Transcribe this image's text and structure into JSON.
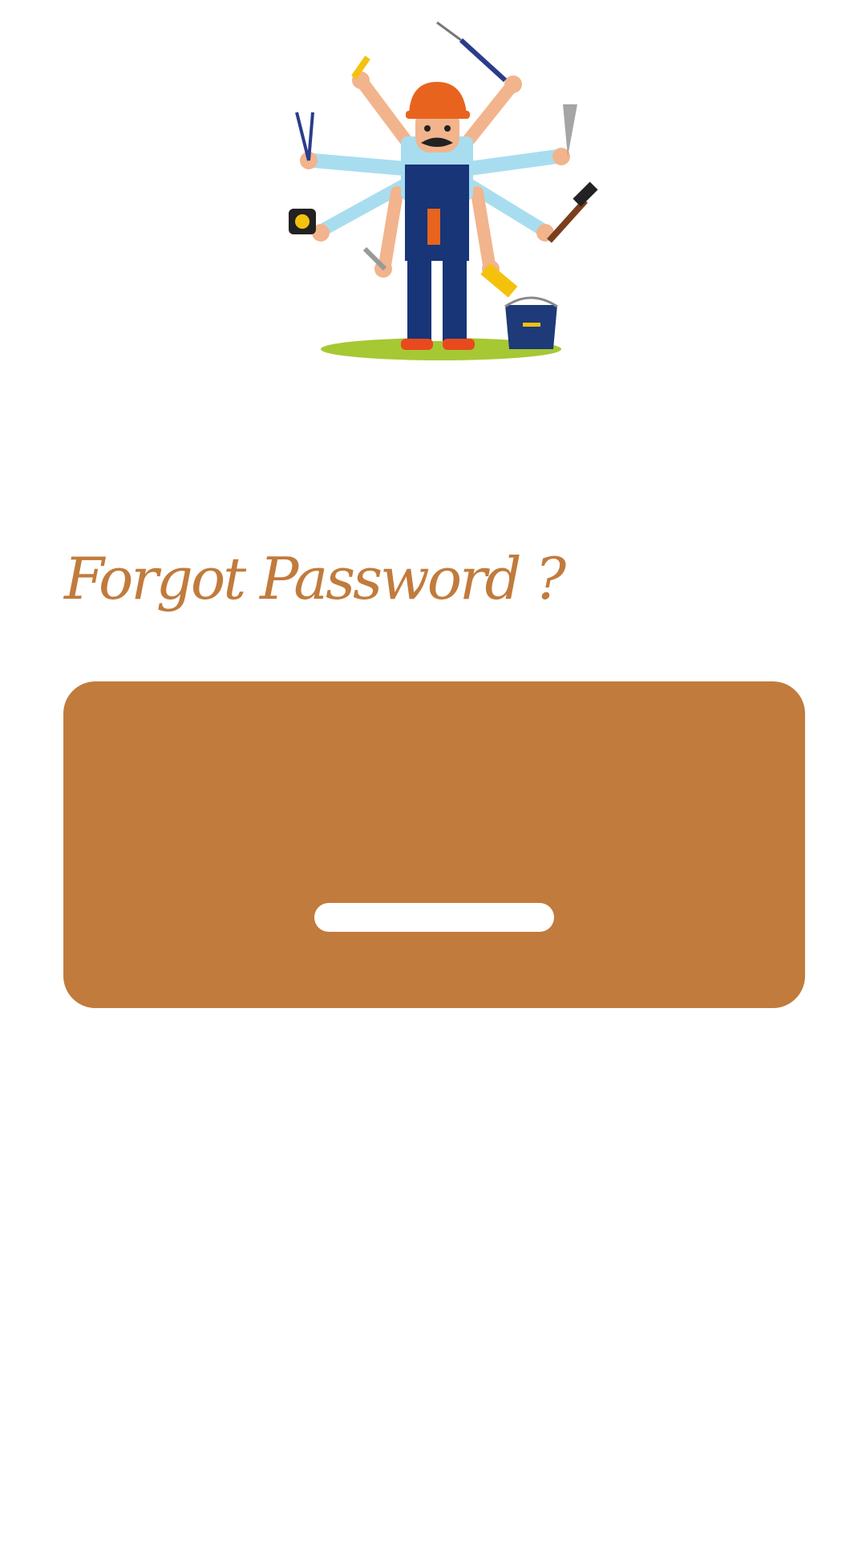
{
  "colors": {
    "accent": "#C17B3C",
    "background": "#FFFFFF",
    "button": "#FFFFFF"
  },
  "hero": {
    "icon": "handyman-illustration-icon"
  },
  "page": {
    "title": "Forgot Password ?"
  },
  "card": {
    "button_label": ""
  }
}
